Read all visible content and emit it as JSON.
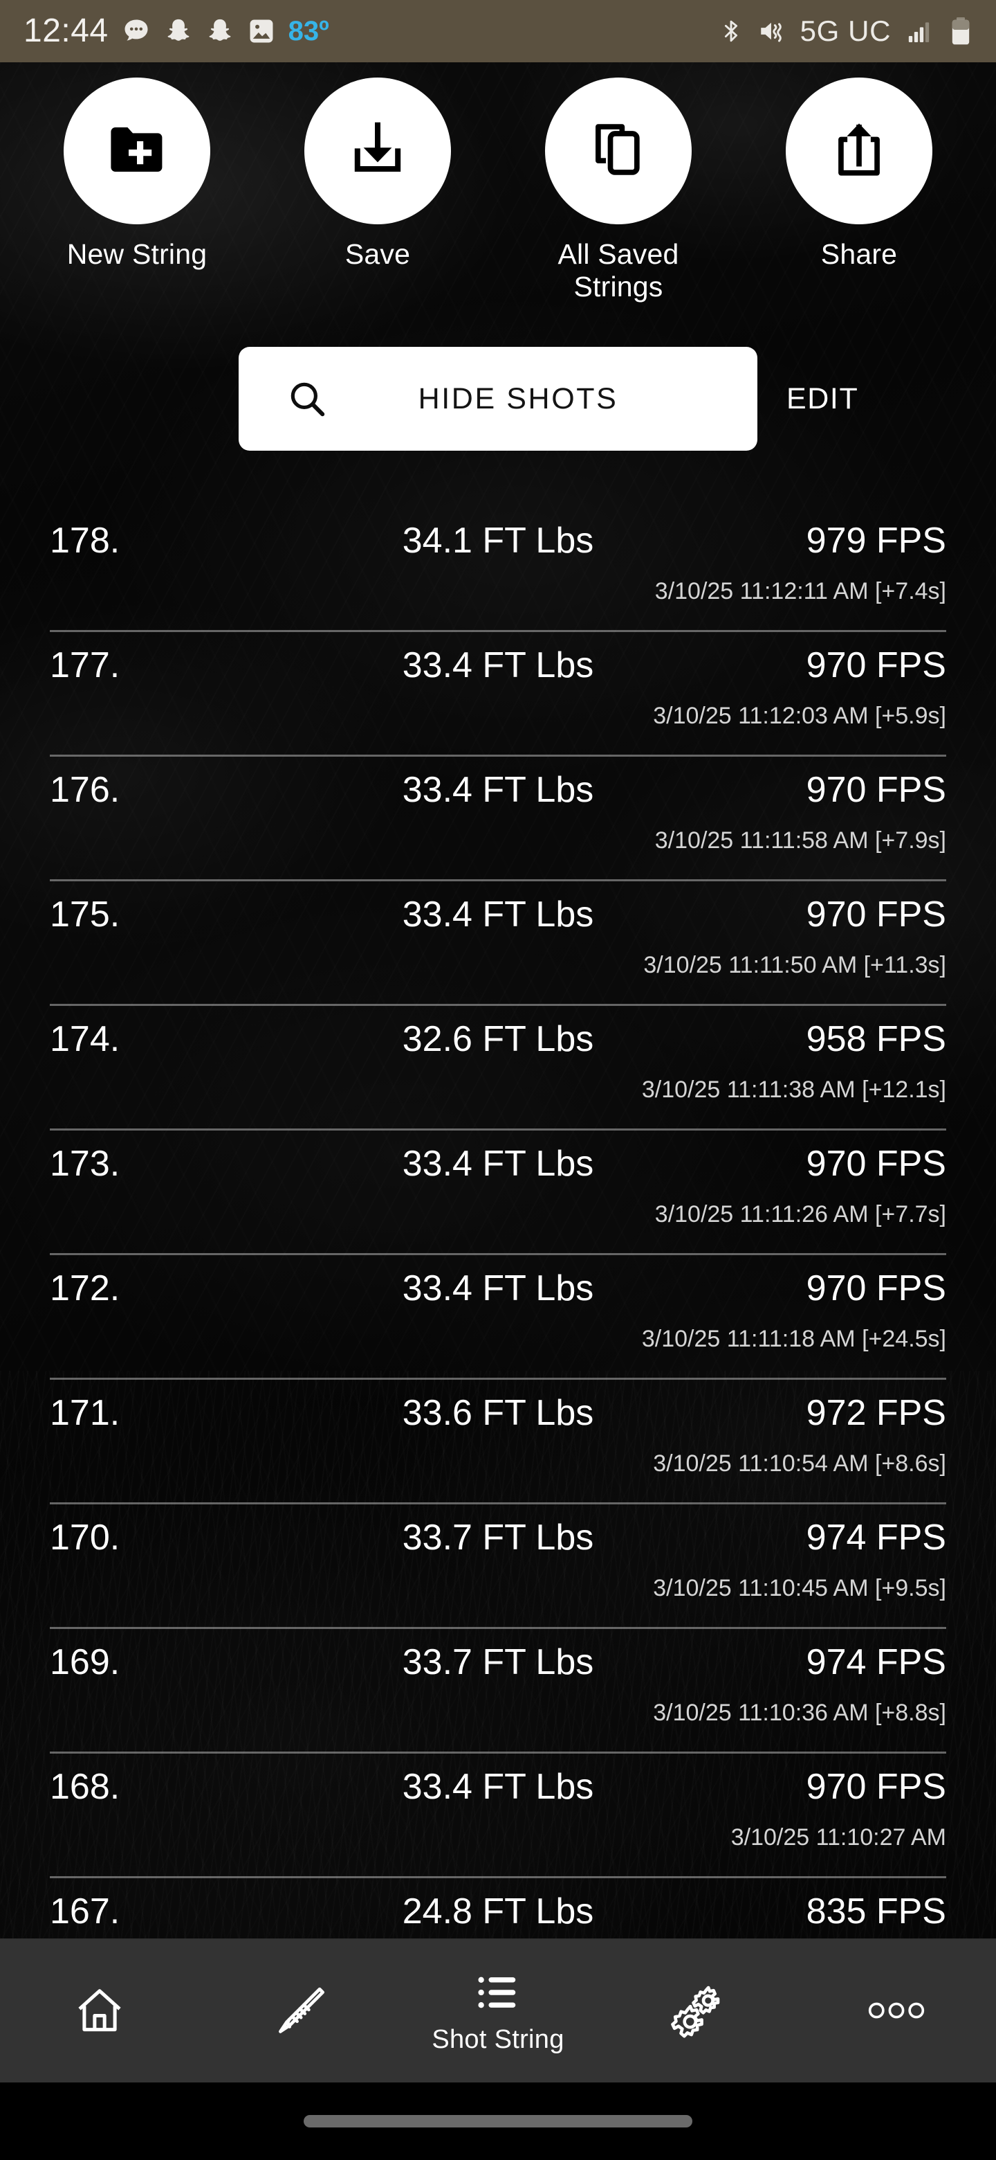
{
  "status_bar": {
    "time": "12:44",
    "left_icons": [
      "message-bubble-icon",
      "snapchat-ghost-icon",
      "snapchat-ghost-icon",
      "photo-icon"
    ],
    "temperature": "83º",
    "temperature_color": "#36b4e8",
    "network": "5G UC",
    "right_icons": [
      "bluetooth-icon",
      "mute-vibrate-icon",
      "signal-bars-icon",
      "battery-icon"
    ],
    "background_color": "#5b5140"
  },
  "actions": [
    {
      "label": "New String",
      "icon": "folder-plus-icon"
    },
    {
      "label": "Save",
      "icon": "download-icon"
    },
    {
      "label": "All Saved Strings",
      "icon": "copy-icon"
    },
    {
      "label": "Share",
      "icon": "share-upload-icon"
    }
  ],
  "search": {
    "label": "HIDE SHOTS",
    "icon": "search-icon"
  },
  "edit": {
    "label": "EDIT"
  },
  "shots": [
    {
      "index": "178.",
      "energy": "34.1 FT Lbs",
      "speed": "979 FPS",
      "time": "3/10/25 11:12:11 AM [+7.4s]"
    },
    {
      "index": "177.",
      "energy": "33.4 FT Lbs",
      "speed": "970 FPS",
      "time": "3/10/25 11:12:03 AM [+5.9s]"
    },
    {
      "index": "176.",
      "energy": "33.4 FT Lbs",
      "speed": "970 FPS",
      "time": "3/10/25 11:11:58 AM [+7.9s]"
    },
    {
      "index": "175.",
      "energy": "33.4 FT Lbs",
      "speed": "970 FPS",
      "time": "3/10/25 11:11:50 AM [+11.3s]"
    },
    {
      "index": "174.",
      "energy": "32.6 FT Lbs",
      "speed": "958 FPS",
      "time": "3/10/25 11:11:38 AM [+12.1s]"
    },
    {
      "index": "173.",
      "energy": "33.4 FT Lbs",
      "speed": "970 FPS",
      "time": "3/10/25 11:11:26 AM [+7.7s]"
    },
    {
      "index": "172.",
      "energy": "33.4 FT Lbs",
      "speed": "970 FPS",
      "time": "3/10/25 11:11:18 AM [+24.5s]"
    },
    {
      "index": "171.",
      "energy": "33.6 FT Lbs",
      "speed": "972 FPS",
      "time": "3/10/25 11:10:54 AM [+8.6s]"
    },
    {
      "index": "170.",
      "energy": "33.7 FT Lbs",
      "speed": "974 FPS",
      "time": "3/10/25 11:10:45 AM [+9.5s]"
    },
    {
      "index": "169.",
      "energy": "33.7 FT Lbs",
      "speed": "974 FPS",
      "time": "3/10/25 11:10:36 AM [+8.8s]"
    },
    {
      "index": "168.",
      "energy": "33.4 FT Lbs",
      "speed": "970 FPS",
      "time": "3/10/25 11:10:27 AM"
    },
    {
      "index": "167.",
      "energy": "24.8 FT Lbs",
      "speed": "835 FPS",
      "time": ""
    }
  ],
  "bottom_nav": [
    {
      "label": "",
      "icon": "home-icon",
      "active": false
    },
    {
      "label": "",
      "icon": "rifle-icon",
      "active": false
    },
    {
      "label": "Shot String",
      "icon": "list-icon",
      "active": true
    },
    {
      "label": "",
      "icon": "gears-icon",
      "active": false
    },
    {
      "label": "",
      "icon": "more-dots-icon",
      "active": false
    }
  ]
}
